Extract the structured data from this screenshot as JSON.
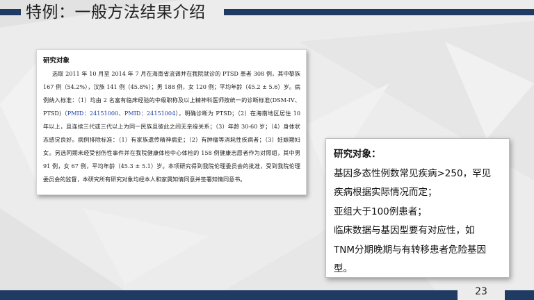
{
  "slide": {
    "title": "特例：一般方法结果介绍",
    "page_number": "23"
  },
  "excerpt": {
    "heading": "研究对象",
    "text_a": "选取 2011 年 10 月至 2014 年 7 月在海南省流调并在我院就诊的 PTSD 患者 308 例，其中黎族 167 例（54.2%），汉族 141 例（45.8%）；男 188 例，女 120 例；平均年龄（45.2 ± 5.6）岁。病例纳入标准：（1）均由 2 名富有临床经验的中级职称及以上精神科医师按统一的诊断标准(DSM-IV、PTSD)（",
    "pmid": "PMID：24151000、PMID：24151004",
    "text_b": "），明确诊断为 PTSD；（2）在海南地区居住 10 年以上，且连续三代或三代以上为同一民族且彼此之间无亲缘关系；（3）年龄 30-60 岁；（4）身体状态感觉良好。病例排除标准：（1）有家族遗传精神病史；（2）有肿瘤等消耗性疾病者；（3）妊娠期妇女。另选同期未经受创伤性事件并在我院健康体检中心体检的 158 例健康志愿者作为对照组，其中男 91 例，女 67 例，平均年龄（45.3 ± 5.1）岁。本项研究得到我院伦理委员会的批准，受到我院伦理委员会的监督，本研究所有研究对象均经本人和家属知情同意并签署知情同意书。"
  },
  "callout": {
    "title": "研究对象：",
    "lines": [
      "基因多态性例数常见疾病>250，罕见",
      "疾病根据实际情况而定；",
      "亚组大于100例患者；",
      "临床数据与基因型要有对应性，如",
      "TNM分期晚期与有转移患者危险基因",
      "型。"
    ]
  },
  "colors": {
    "accent_bar": "#1f3a63",
    "background": "#ececec",
    "pmid_link": "#1f3ea8"
  }
}
